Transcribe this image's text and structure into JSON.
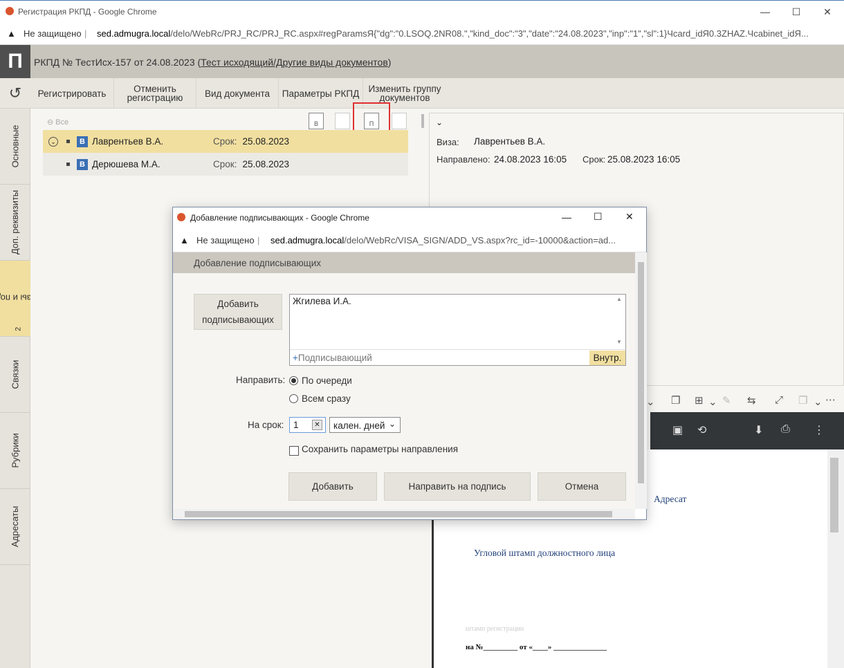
{
  "main_window": {
    "title": "Регистрация РКПД - Google Chrome",
    "not_secure": "Не защищено",
    "url_host": "sed.admugra.local",
    "url_path": "/delo/WebRc/PRJ_RC/PRJ_RC.aspx#regParamsЯ{\"dg\":\"0.LSOQ.2NR08.\",\"kind_doc\":\"3\",\"date\":\"24.08.2023\",\"inp\":\"1\",\"sl\":1}Чcard_idЯ0.3ZHAZ.Чcabinet_idЯ..."
  },
  "header": {
    "logo": "П",
    "doc_prefix": "РКПД №  ТестИсх-157 от 24.08.2023 (",
    "doc_link": "Тест исходящий/Другие виды документов",
    "doc_suffix": ")"
  },
  "toolbar": {
    "register": "Регистрировать",
    "cancel_reg_1": "Отменить",
    "cancel_reg_2": "регистрацию",
    "doc_type": "Вид документа",
    "params": "Параметры РКПД",
    "change_group_1": "Изменить группу",
    "change_group_2": "документов"
  },
  "sidebar": {
    "tabs": [
      "Основные",
      "Доп. реквизиты",
      "Визы и подписи",
      "Связки",
      "Рубрики",
      "Адресаты"
    ],
    "badge": "2"
  },
  "visa_list": {
    "all_label": "Все",
    "icon_labels": [
      "В",
      "",
      "П",
      ""
    ],
    "due_label": "Срок:",
    "rows": [
      {
        "type": "В",
        "name": "Лаврентьев В.А.",
        "due": "25.08.2023"
      },
      {
        "type": "В",
        "name": "Дерюшева М.А.",
        "due": "25.08.2023"
      }
    ]
  },
  "detail": {
    "visa_label": "Виза:",
    "visa_value": "Лаврентьев В.А.",
    "sent_label": "Направлено:",
    "sent_value": "24.08.2023 16:05",
    "due_label": "Срок:",
    "due_value": "25.08.2023 16:05"
  },
  "pdf": {
    "addressee": "Адресат",
    "corner_stamp": "Угловой штамп должностного лица",
    "reg_stamp": "штамп регистрации",
    "number_line": "на №_________ от «____» ______________"
  },
  "modal": {
    "title": "Добавление подписывающих - Google Chrome",
    "not_secure": "Не защищено",
    "url_host": "sed.admugra.local",
    "url_path": "/delo/WebRc/VISA_SIGN/ADD_VS.aspx?rc_id=-10000&action=ad...",
    "header": "Добавление подписывающих",
    "add_signers_1": "Добавить",
    "add_signers_2": "подписывающих",
    "signers": [
      "Жгилева И.А."
    ],
    "signer_placeholder": "Подписывающий",
    "internal_btn": "Внутр.",
    "send_label": "Направить:",
    "option_queue": "По очереди",
    "option_all": "Всем сразу",
    "term_label": "На срок:",
    "term_value": "1",
    "term_unit": "кален. дней",
    "save_params": "Сохранить параметры направления",
    "btn_add": "Добавить",
    "btn_send": "Направить на подпись",
    "btn_cancel": "Отмена"
  }
}
